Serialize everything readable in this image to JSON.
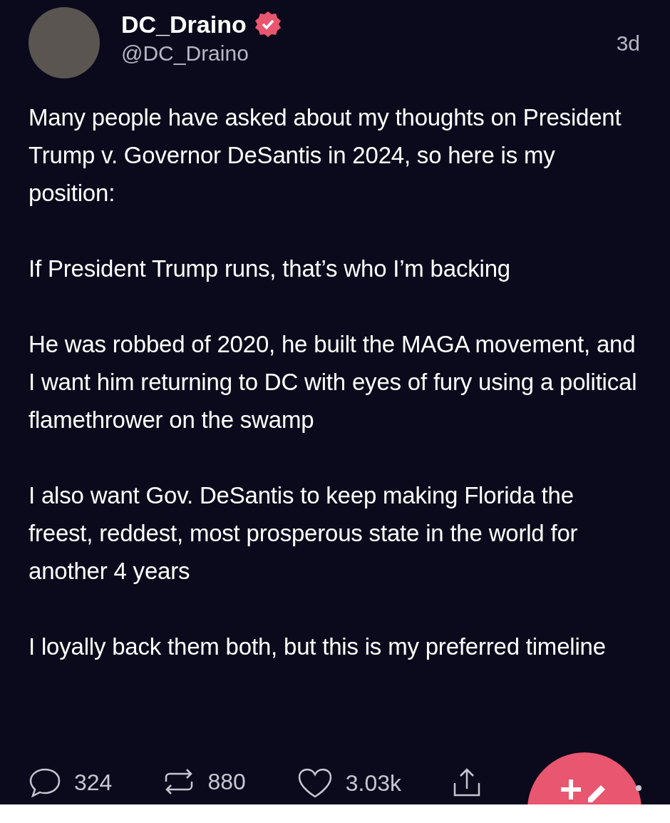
{
  "post": {
    "author": {
      "name": "DC_Draino",
      "handle": "@DC_Draino",
      "verified": true
    },
    "time": "3d",
    "paragraphs": [
      "Many people have asked about my thoughts on President Trump v. Governor DeSantis in 2024, so here is my position:",
      "If President Trump runs, that’s who I’m backing",
      "He was robbed of 2020, he built the MAGA movement, and I want him returning to DC with eyes of fury using a political flamethrower on the swamp",
      "I also want Gov. DeSantis to keep making Florida the freest, reddest, most prosperous state in the world for another 4 years",
      "I loyally back them both, but this is my preferred timeline"
    ],
    "actions": [
      {
        "kind": "reply",
        "count": "324"
      },
      {
        "kind": "repost",
        "count": "880"
      },
      {
        "kind": "like",
        "count": "3.03k"
      },
      {
        "kind": "share"
      }
    ]
  }
}
